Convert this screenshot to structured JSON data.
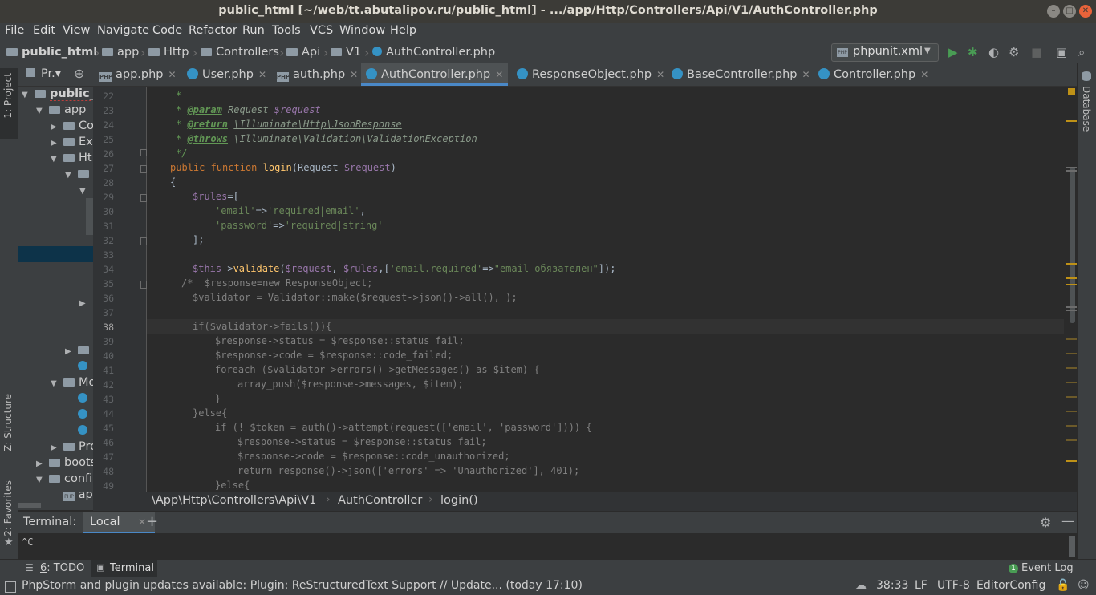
{
  "window": {
    "title": "public_html [~/web/tt.abutalipov.ru/public_html] - .../app/Http/Controllers/Api/V1/AuthController.php"
  },
  "menu": [
    "File",
    "Edit",
    "View",
    "Navigate",
    "Code",
    "Refactor",
    "Run",
    "Tools",
    "VCS",
    "Window",
    "Help"
  ],
  "navbar": {
    "crumbs": [
      "public_html",
      "app",
      "Http",
      "Controllers",
      "Api",
      "V1",
      "AuthController.php"
    ],
    "run_config": "phpunit.xml"
  },
  "left_strip": {
    "project": "1: Project",
    "structure": "Z: Structure",
    "favorites": "2: Favorites"
  },
  "right_strip": {
    "database": "Database"
  },
  "project_panel": {
    "header": "Pr.▾",
    "root": "public_",
    "app": "app",
    "items": [
      "Co",
      "Ex",
      "Ht",
      "Mo",
      "Pro",
      "boots",
      "confi",
      "ap"
    ]
  },
  "tabs": [
    {
      "label": "app.php",
      "icon": "php"
    },
    {
      "label": "User.php",
      "icon": "class"
    },
    {
      "label": "auth.php",
      "icon": "php"
    },
    {
      "label": "AuthController.php",
      "icon": "class",
      "active": true
    },
    {
      "label": "ResponseObject.php",
      "icon": "class"
    },
    {
      "label": "BaseController.php",
      "icon": "class"
    },
    {
      "label": "Controller.php",
      "icon": "class"
    }
  ],
  "code": {
    "line_numbers": [
      "22",
      "23",
      "24",
      "25",
      "26",
      "27",
      "28",
      "29",
      "30",
      "31",
      "32",
      "33",
      "34",
      "35",
      "36",
      "37",
      "38",
      "39",
      "40",
      "41",
      "42",
      "43",
      "44",
      "45",
      "46",
      "47",
      "48",
      "49"
    ],
    "l23_tag": "@param",
    "l23_type": "Request",
    "l23_var": "$request",
    "l24_tag": "@return",
    "l24_type": "\\Illuminate\\Http\\JsonResponse",
    "l25_tag": "@throws",
    "l25_type": "\\Illuminate\\Validation\\ValidationException",
    "l27_public": "public",
    "l27_function": "function",
    "l27_name": "login",
    "l27_type": "Request",
    "l27_var": "$request",
    "l29_var": "$rules",
    "l30_key": "'email'",
    "l30_val": "'required|email'",
    "l31_key": "'password'",
    "l31_val": "'required|string'",
    "l34_this": "$this",
    "l34_fn": "validate",
    "l34_v1": "$request",
    "l34_v2": "$rules",
    "l34_k": "'email.required'",
    "l34_s": "\"email обязателен\"",
    "l35": "/*  $response=new ResponseObject;",
    "l36": "$validator = Validator::make($request->json()->all(), );",
    "l38": "if($validator->fails()){",
    "l39": "$response->status = $response::status_fail;",
    "l40": "$response->code = $response::code_failed;",
    "l41": "foreach ($validator->errors()->getMessages() as $item) {",
    "l42": "array_push($response->messages, $item);",
    "l43": "}",
    "l44": "}else{",
    "l45": "if (! $token = auth()->attempt(request(['email', 'password']))) {",
    "l46": "$response->status = $response::status_fail;",
    "l47": "$response->code = $response::code_unauthorized;",
    "l48": "return response()->json(['errors' => 'Unauthorized'], 401);",
    "l49": "}else{"
  },
  "editor_breadcrumb": [
    "\\App\\Http\\Controllers\\Api\\V1",
    "AuthController",
    "login()"
  ],
  "terminal": {
    "label": "Terminal:",
    "tab": "Local",
    "output": "^C"
  },
  "tool_buttons": {
    "todo_num": "6",
    "todo": ": TODO",
    "terminal": "Terminal",
    "event_log": "Event Log"
  },
  "status": {
    "message": "PhpStorm and plugin updates available: Plugin: ReStructuredText Support // Update... (today 17:10)",
    "position": "38:33",
    "line_sep": "LF",
    "encoding": "UTF-8",
    "config": "EditorConfig"
  },
  "colors": {
    "accent": "#4a88c7",
    "background": "#2b2b2b",
    "panel": "#3c3f41"
  }
}
